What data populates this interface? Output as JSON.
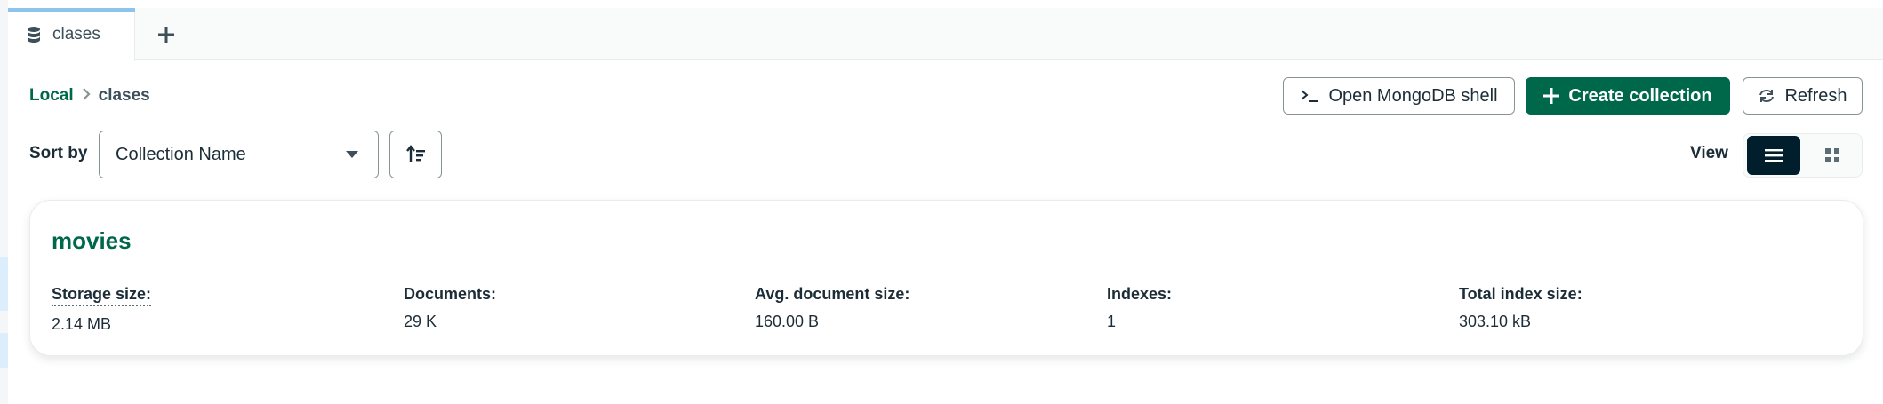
{
  "tabs": [
    {
      "label": "clases",
      "icon": "database-icon"
    }
  ],
  "new_tab_icon": "plus-icon",
  "breadcrumb": {
    "root": "Local",
    "current": "clases"
  },
  "toolbar": {
    "shell_label": "Open MongoDB shell",
    "create_label": "Create collection",
    "refresh_label": "Refresh"
  },
  "sort": {
    "label": "Sort by",
    "selected": "Collection Name"
  },
  "view": {
    "label": "View",
    "active": "list"
  },
  "collections": [
    {
      "name": "movies",
      "stats": [
        {
          "label": "Storage size:",
          "value": "2.14 MB"
        },
        {
          "label": "Documents:",
          "value": "29 K"
        },
        {
          "label": "Avg. document size:",
          "value": "160.00 B"
        },
        {
          "label": "Indexes:",
          "value": "1"
        },
        {
          "label": "Total index size:",
          "value": "303.10 kB"
        }
      ]
    }
  ],
  "colors": {
    "accent": "#00684a",
    "tab_indicator": "#8bc4ef",
    "dark": "#001e2b"
  }
}
